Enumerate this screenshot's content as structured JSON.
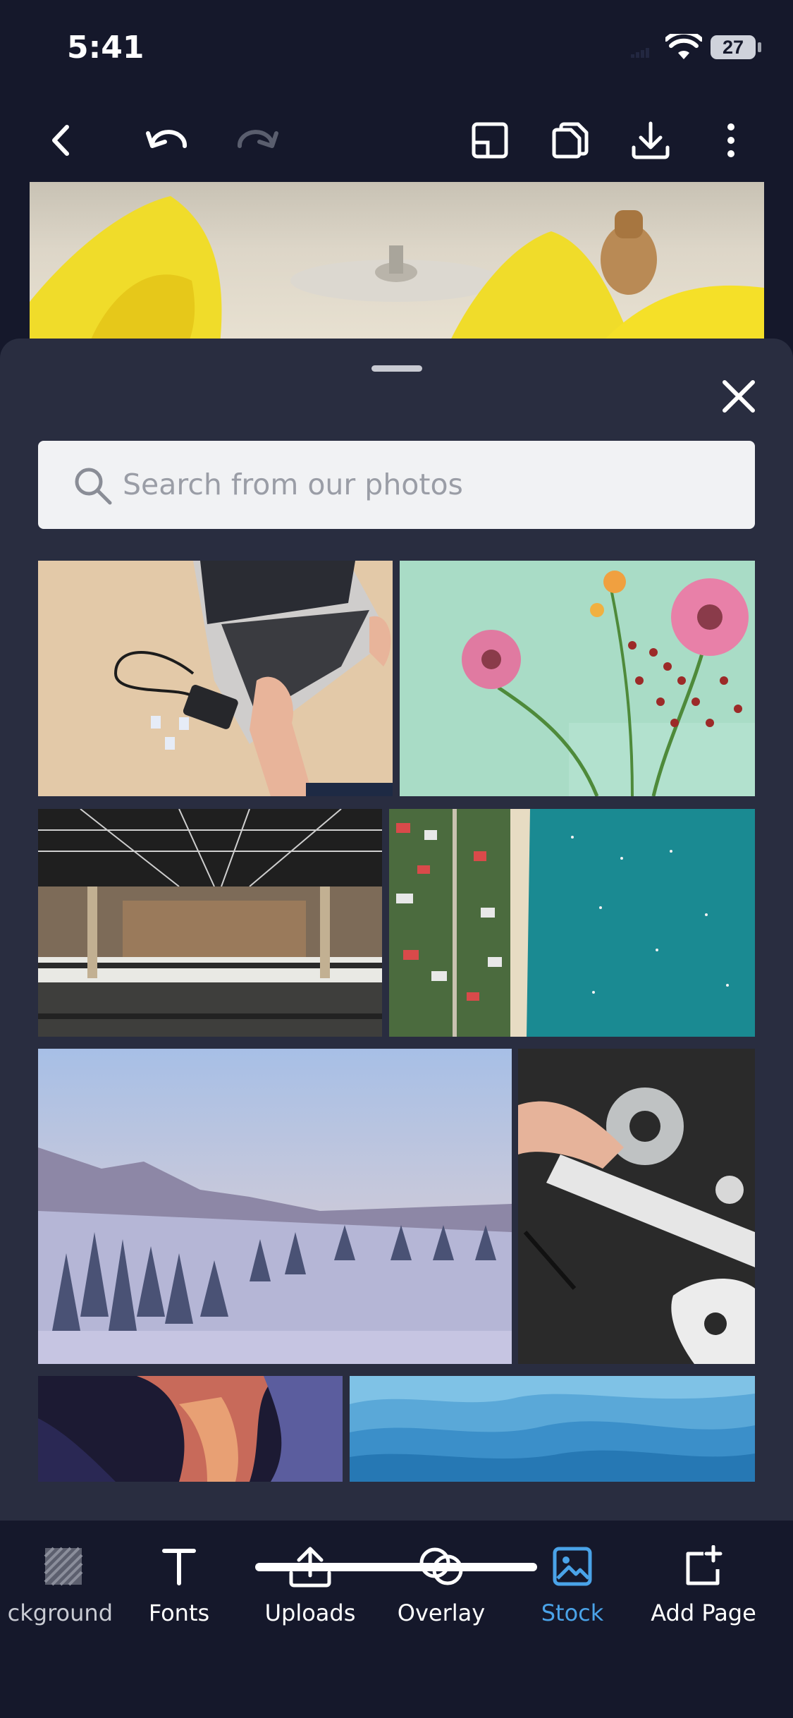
{
  "status": {
    "time": "5:41",
    "battery": "27"
  },
  "toolbar": {
    "back": "back-icon",
    "undo": "undo-icon",
    "redo": "redo-icon",
    "resize": "resize-icon",
    "duplicate": "duplicate-icon",
    "download": "download-icon",
    "more": "more-icon"
  },
  "panel": {
    "search": {
      "placeholder": "Search from our photos",
      "value": ""
    },
    "photos": [
      {
        "subject": "laptop-hands"
      },
      {
        "subject": "pink-flowers"
      },
      {
        "subject": "train-station"
      },
      {
        "subject": "aerial-beach"
      },
      {
        "subject": "snowy-forest"
      },
      {
        "subject": "console-repair"
      },
      {
        "subject": "canyon"
      },
      {
        "subject": "blue-mountains"
      }
    ]
  },
  "bottom_nav": {
    "items": [
      {
        "label": "ckground",
        "icon": "background-icon"
      },
      {
        "label": "Fonts",
        "icon": "text-icon"
      },
      {
        "label": "Uploads",
        "icon": "upload-icon"
      },
      {
        "label": "Overlay",
        "icon": "overlay-icon"
      },
      {
        "label": "Stock",
        "icon": "image-icon",
        "active": true
      },
      {
        "label": "Add Page",
        "icon": "add-page-icon"
      }
    ]
  },
  "colors": {
    "accent": "#4aa3e8",
    "sheet": "#292d40",
    "chrome": "#15182b"
  }
}
